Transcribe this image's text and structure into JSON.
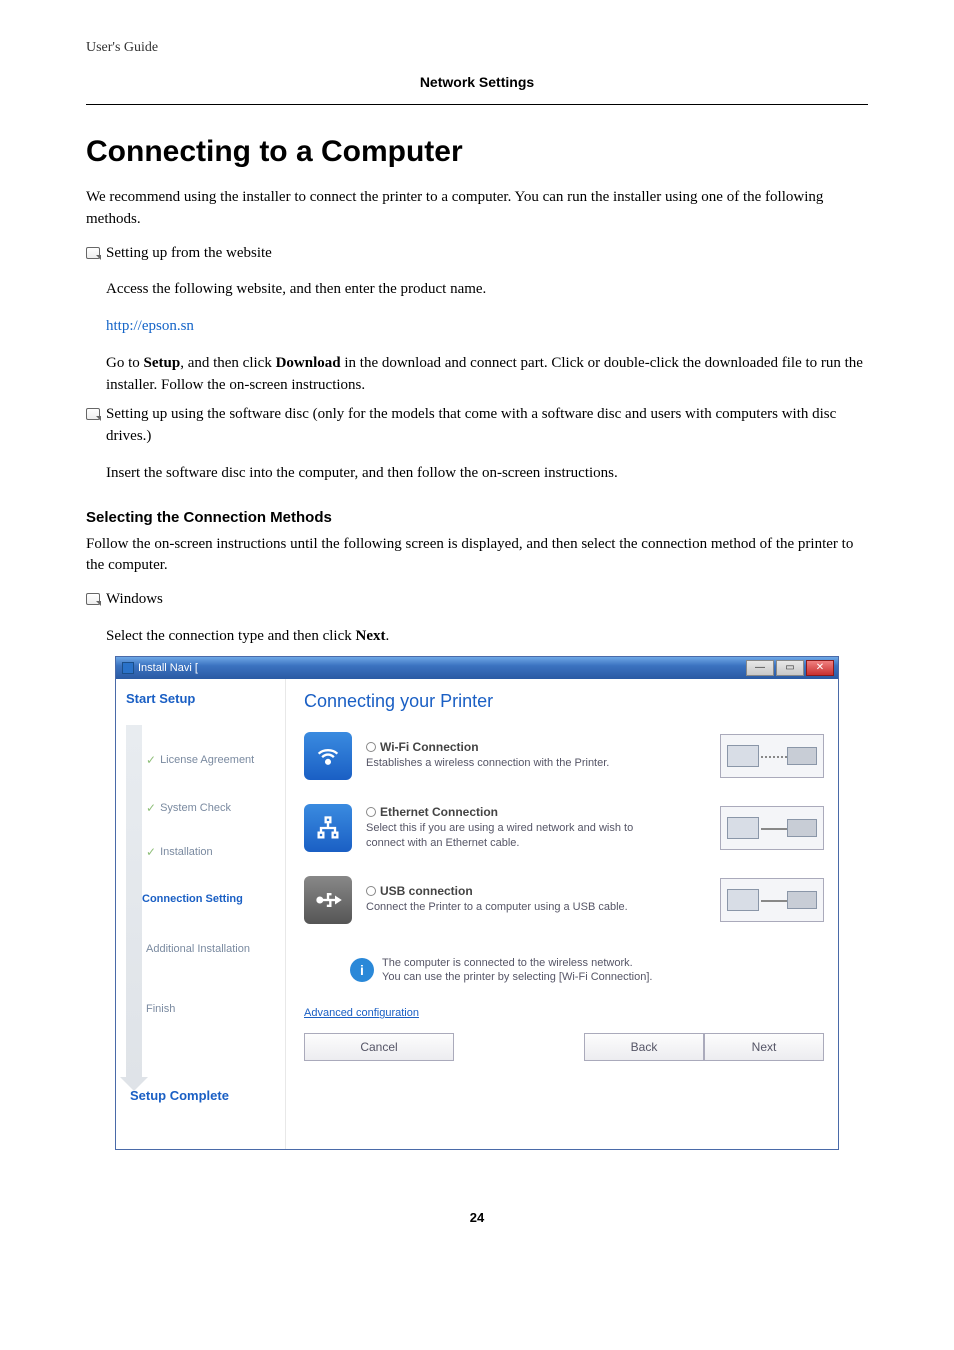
{
  "header": {
    "doc_title": "User's Guide",
    "section": "Network Settings"
  },
  "heading": "Connecting to a Computer",
  "intro": "We recommend using the installer to connect the printer to a computer. You can run the installer using one of the following methods.",
  "bullet1": {
    "title": "Setting up from the website",
    "line1": "Access the following website, and then enter the product name.",
    "link": "http://epson.sn",
    "line2a": "Go to ",
    "setup_bold": "Setup",
    "line2b": ", and then click ",
    "download_bold": "Download",
    "line2c": " in the download and connect part. Click or double-click the downloaded file to run the installer. Follow the on-screen instructions."
  },
  "bullet2": {
    "title": "Setting up using the software disc (only for the models that come with a software disc and users with computers with disc drives.)",
    "line1": "Insert the software disc into the computer, and then follow the on-screen instructions."
  },
  "subhead": "Selecting the Connection Methods",
  "subhead_text": "Follow the on-screen instructions until the following screen is displayed, and then select the connection method of the printer to the computer.",
  "bullet3": {
    "title": "Windows",
    "line1a": "Select the connection type and then click ",
    "next_bold": "Next",
    "line1b": "."
  },
  "dialog": {
    "titlebar": "Install Navi [",
    "sidebar": {
      "start": "Start Setup",
      "steps": {
        "license": "License Agreement",
        "syscheck": "System Check",
        "install": "Installation",
        "connection": "Connection Setting",
        "additional": "Additional Installation",
        "finish": "Finish"
      },
      "complete": "Setup Complete"
    },
    "main": {
      "title": "Connecting your Printer",
      "wifi": {
        "title": "Wi-Fi Connection",
        "desc": "Establishes a wireless connection with the Printer."
      },
      "eth": {
        "title": "Ethernet Connection",
        "desc": "Select this if you are using a wired network and wish to connect with an Ethernet cable."
      },
      "usb": {
        "title": "USB connection",
        "desc": "Connect the Printer to a computer using a USB cable."
      },
      "info1": "The computer is connected to the wireless network.",
      "info2": "You can use the printer by selecting [Wi-Fi Connection].",
      "adv": "Advanced configuration",
      "cancel": "Cancel",
      "back": "Back",
      "next": "Next"
    }
  },
  "page_number": "24"
}
